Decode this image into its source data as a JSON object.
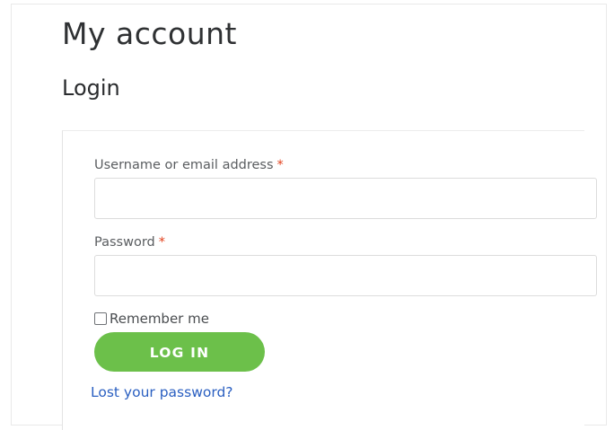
{
  "page": {
    "title": "My account"
  },
  "login": {
    "heading": "Login",
    "username_label": "Username or email address",
    "password_label": "Password",
    "required_mark": "*",
    "username_value": "",
    "password_value": "",
    "remember_label": "Remember me",
    "remember_checked": false,
    "submit_label": "LOG IN",
    "lost_password_label": "Lost your password?"
  },
  "colors": {
    "button_bg": "#6cc04a",
    "link": "#2a5fc1",
    "required": "#e2401c"
  }
}
